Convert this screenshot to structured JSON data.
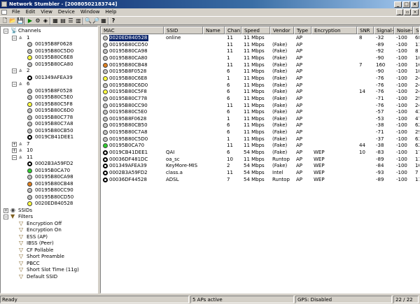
{
  "window": {
    "title": "Network Stumbler - [20080502183744]"
  },
  "menu": {
    "items": [
      "File",
      "Edit",
      "View",
      "Device",
      "Window",
      "Help"
    ]
  },
  "toolbar": {
    "tools": [
      {
        "name": "new-file-icon",
        "glyph": "🗋"
      },
      {
        "name": "open-file-icon",
        "glyph": "📂"
      },
      {
        "name": "save-file-icon",
        "glyph": "💾"
      },
      {
        "name": "play-scan-icon",
        "glyph": "▶"
      },
      {
        "name": "auto-config-icon",
        "glyph": "⚙"
      },
      {
        "name": "scan-speed-icon",
        "glyph": "◈"
      },
      {
        "name": "large-icons-icon",
        "glyph": "▦"
      },
      {
        "name": "small-icons-icon",
        "glyph": "▤"
      },
      {
        "name": "list-view-icon",
        "glyph": "☰"
      },
      {
        "name": "details-view-icon",
        "glyph": "▥"
      },
      {
        "name": "zoom-in-icon",
        "glyph": "🔍"
      },
      {
        "name": "zoom-out-icon",
        "glyph": "🔎"
      },
      {
        "name": "grid-icon",
        "glyph": "▦"
      },
      {
        "name": "help-icon",
        "glyph": "?"
      }
    ]
  },
  "tree": {
    "channels_label": "Channels",
    "ssids_label": "SSIDs",
    "filters_label": "Filters",
    "nodes": [
      {
        "kind": "channel",
        "label": "1",
        "expanded": true
      },
      {
        "kind": "ap",
        "label": "00195B8F0628",
        "color": "#c0c0c0"
      },
      {
        "kind": "ap",
        "label": "00195B80C5D0",
        "color": "#c0c0c0"
      },
      {
        "kind": "ap",
        "label": "00195B80C6E8",
        "color": "#ffff40"
      },
      {
        "kind": "ap",
        "label": "00195B80CA80",
        "color": "#c0c0c0"
      },
      {
        "kind": "channel",
        "label": "2",
        "expanded": true
      },
      {
        "kind": "ap",
        "label": "001349AFEA39",
        "color": "#000000"
      },
      {
        "kind": "channel",
        "label": "6",
        "expanded": true
      },
      {
        "kind": "ap",
        "label": "00195B8F0528",
        "color": "#c0c0c0"
      },
      {
        "kind": "ap",
        "label": "00195B80C5E0",
        "color": "#c0c0c0"
      },
      {
        "kind": "ap",
        "label": "00195B80C5F8",
        "color": "#ffff40"
      },
      {
        "kind": "ap",
        "label": "00195B80C6D0",
        "color": "#c0c0c0"
      },
      {
        "kind": "ap",
        "label": "00195B80C778",
        "color": "#c0c0c0"
      },
      {
        "kind": "ap",
        "label": "00195B80C7A8",
        "color": "#c0c0c0"
      },
      {
        "kind": "ap",
        "label": "00195B80CB50",
        "color": "#c0c0c0"
      },
      {
        "kind": "ap",
        "label": "0019CB41DEE1",
        "color": "#000000"
      },
      {
        "kind": "channel",
        "label": "7",
        "expanded": false
      },
      {
        "kind": "channel",
        "label": "10",
        "expanded": false
      },
      {
        "kind": "channel",
        "label": "11",
        "expanded": true
      },
      {
        "kind": "ap",
        "label": "0002B3A59FD2",
        "color": "#000000"
      },
      {
        "kind": "ap",
        "label": "00195B0CA70",
        "color": "#30d030"
      },
      {
        "kind": "ap",
        "label": "00195B80CA98",
        "color": "#c0c0c0"
      },
      {
        "kind": "ap",
        "label": "00195B80CB48",
        "color": "#e08020"
      },
      {
        "kind": "ap",
        "label": "00195B80CC90",
        "color": "#c0c0c0"
      },
      {
        "kind": "ap",
        "label": "00195B80CD50",
        "color": "#c0c0c0"
      },
      {
        "kind": "ap",
        "label": "0020ED840528",
        "color": "#ffff40"
      }
    ],
    "filters": [
      "Encryption Off",
      "Encryption On",
      "ESS (AP)",
      "IBSS (Peer)",
      "CF Pollable",
      "Short Preamble",
      "PBCC",
      "Short Slot Time (11g)",
      "Default SSID"
    ]
  },
  "table": {
    "columns": [
      "MAC",
      "SSID",
      "Name",
      "Chan",
      "Speed",
      "Vendor",
      "Type",
      "Encryption",
      "SNR",
      "Signal+",
      "Noise-",
      "SN"
    ],
    "rows": [
      {
        "icon": "#c0c0c0",
        "mac": "0020ED840528",
        "ssid": "online",
        "name": "",
        "chan": "11",
        "speed": "11 Mbps",
        "vendor": "",
        "type": "AP",
        "enc": "",
        "snr": "8",
        "signal": "-32",
        "noise": "-100",
        "sn": "68",
        "selected": true
      },
      {
        "icon": "#c0c0c0",
        "mac": "00195B80CD50",
        "ssid": "",
        "name": "",
        "chan": "11",
        "speed": "11 Mbps",
        "vendor": "(Fake)",
        "type": "AP",
        "enc": "",
        "snr": "",
        "signal": "-89",
        "noise": "-100",
        "sn": "11"
      },
      {
        "icon": "#c0c0c0",
        "mac": "00195B80CA98",
        "ssid": "",
        "name": "",
        "chan": "11",
        "speed": "11 Mbps",
        "vendor": "(Fake)",
        "type": "AP",
        "enc": "",
        "snr": "",
        "signal": "-92",
        "noise": "-100",
        "sn": "8"
      },
      {
        "icon": "#c0c0c0",
        "mac": "00195B80CA80",
        "ssid": "",
        "name": "",
        "chan": "1",
        "speed": "11 Mbps",
        "vendor": "(Fake)",
        "type": "AP",
        "enc": "",
        "snr": "",
        "signal": "-90",
        "noise": "-100",
        "sn": "10"
      },
      {
        "icon": "#e08020",
        "mac": "00195B80CB48",
        "ssid": "",
        "name": "",
        "chan": "11",
        "speed": "11 Mbps",
        "vendor": "(Fake)",
        "type": "AP",
        "enc": "",
        "snr": "7",
        "signal": "160",
        "noise": "-100",
        "sn": "16"
      },
      {
        "icon": "#c0c0c0",
        "mac": "00195B8F0528",
        "ssid": "",
        "name": "",
        "chan": "6",
        "speed": "11 Mbps",
        "vendor": "(Fake)",
        "type": "AP",
        "enc": "",
        "snr": "",
        "signal": "-90",
        "noise": "-100",
        "sn": "10"
      },
      {
        "icon": "#ffff40",
        "mac": "00195B80C6E8",
        "ssid": "",
        "name": "",
        "chan": "1",
        "speed": "11 Mbps",
        "vendor": "(Fake)",
        "type": "AP",
        "enc": "",
        "snr": "",
        "signal": "-76",
        "noise": "-100",
        "sn": "24"
      },
      {
        "icon": "#c0c0c0",
        "mac": "00195B80C6D0",
        "ssid": "",
        "name": "",
        "chan": "6",
        "speed": "11 Mbps",
        "vendor": "(Fake)",
        "type": "AP",
        "enc": "",
        "snr": "",
        "signal": "-76",
        "noise": "-100",
        "sn": "24"
      },
      {
        "icon": "#ffff40",
        "mac": "00195B80C5F8",
        "ssid": "",
        "name": "",
        "chan": "6",
        "speed": "11 Mbps",
        "vendor": "(Fake)",
        "type": "AP",
        "enc": "",
        "snr": "14",
        "signal": "-76",
        "noise": "-100",
        "sn": "24"
      },
      {
        "icon": "#c0c0c0",
        "mac": "00195B80C778",
        "ssid": "",
        "name": "",
        "chan": "6",
        "speed": "11 Mbps",
        "vendor": "(Fake)",
        "type": "AP",
        "enc": "",
        "snr": "",
        "signal": "-71",
        "noise": "-100",
        "sn": "29"
      },
      {
        "icon": "#c0c0c0",
        "mac": "00195B80CC90",
        "ssid": "",
        "name": "",
        "chan": "11",
        "speed": "11 Mbps",
        "vendor": "(Fake)",
        "type": "AP",
        "enc": "",
        "snr": "",
        "signal": "-76",
        "noise": "-100",
        "sn": "24"
      },
      {
        "icon": "#c0c0c0",
        "mac": "00195B80C5E0",
        "ssid": "",
        "name": "",
        "chan": "6",
        "speed": "11 Mbps",
        "vendor": "(Fake)",
        "type": "AP",
        "enc": "",
        "snr": "",
        "signal": "-57",
        "noise": "-100",
        "sn": "43"
      },
      {
        "icon": "#c0c0c0",
        "mac": "00195B8F0628",
        "ssid": "",
        "name": "",
        "chan": "1",
        "speed": "11 Mbps",
        "vendor": "(Fake)",
        "type": "AP",
        "enc": "",
        "snr": "",
        "signal": "-53",
        "noise": "-100",
        "sn": "47"
      },
      {
        "icon": "#c0c0c0",
        "mac": "00195B80CB50",
        "ssid": "",
        "name": "",
        "chan": "6",
        "speed": "11 Mbps",
        "vendor": "(Fake)",
        "type": "AP",
        "enc": "",
        "snr": "",
        "signal": "-38",
        "noise": "-100",
        "sn": "62"
      },
      {
        "icon": "#c0c0c0",
        "mac": "00195B80C7A8",
        "ssid": "",
        "name": "",
        "chan": "6",
        "speed": "11 Mbps",
        "vendor": "(Fake)",
        "type": "AP",
        "enc": "",
        "snr": "",
        "signal": "-71",
        "noise": "-100",
        "sn": "29"
      },
      {
        "icon": "#c0c0c0",
        "mac": "00195B80C5D0",
        "ssid": "",
        "name": "",
        "chan": "1",
        "speed": "11 Mbps",
        "vendor": "(Fake)",
        "type": "AP",
        "enc": "",
        "snr": "",
        "signal": "-37",
        "noise": "-100",
        "sn": "63"
      },
      {
        "icon": "#30d030",
        "mac": "00195B0CA70",
        "ssid": "",
        "name": "",
        "chan": "11",
        "speed": "11 Mbps",
        "vendor": "(Fake)",
        "type": "AP",
        "enc": "",
        "snr": "44",
        "signal": "-38",
        "noise": "-100",
        "sn": "62"
      },
      {
        "icon": "#000000",
        "mac": "0019CB41DEE1",
        "ssid": "QAI",
        "name": "",
        "chan": "6",
        "speed": "54 Mbps",
        "vendor": "(Fake)",
        "type": "AP",
        "enc": "WEP",
        "snr": "10",
        "signal": "-83",
        "noise": "-100",
        "sn": "17"
      },
      {
        "icon": "#000000",
        "mac": "00036DF481DC",
        "ssid": "oa_sc",
        "name": "",
        "chan": "10",
        "speed": "11 Mbps",
        "vendor": "Runtop",
        "type": "AP",
        "enc": "WEP",
        "snr": "",
        "signal": "-89",
        "noise": "-100",
        "sn": "11"
      },
      {
        "icon": "#000000",
        "mac": "001349AFEA39",
        "ssid": "KeyMore-MIS",
        "name": "",
        "chan": "2",
        "speed": "54 Mbps",
        "vendor": "(Fake)",
        "type": "AP",
        "enc": "WEP",
        "snr": "",
        "signal": "-84",
        "noise": "-100",
        "sn": "16"
      },
      {
        "icon": "#000000",
        "mac": "0002B3A59FD2",
        "ssid": "class.a",
        "name": "",
        "chan": "11",
        "speed": "54 Mbps",
        "vendor": "Intel",
        "type": "AP",
        "enc": "WEP",
        "snr": "",
        "signal": "-93",
        "noise": "-100",
        "sn": "7"
      },
      {
        "icon": "#000000",
        "mac": "00036DF44528",
        "ssid": "ADSL",
        "name": "",
        "chan": "7",
        "speed": "54 Mbps",
        "vendor": "Runtop",
        "type": "AP",
        "enc": "WEP",
        "snr": "",
        "signal": "-89",
        "noise": "-100",
        "sn": "11"
      }
    ]
  },
  "status": {
    "ready": "Ready",
    "aps_active": "5 APs active",
    "gps": "GPS: Disabled",
    "count": "22 / 22"
  }
}
